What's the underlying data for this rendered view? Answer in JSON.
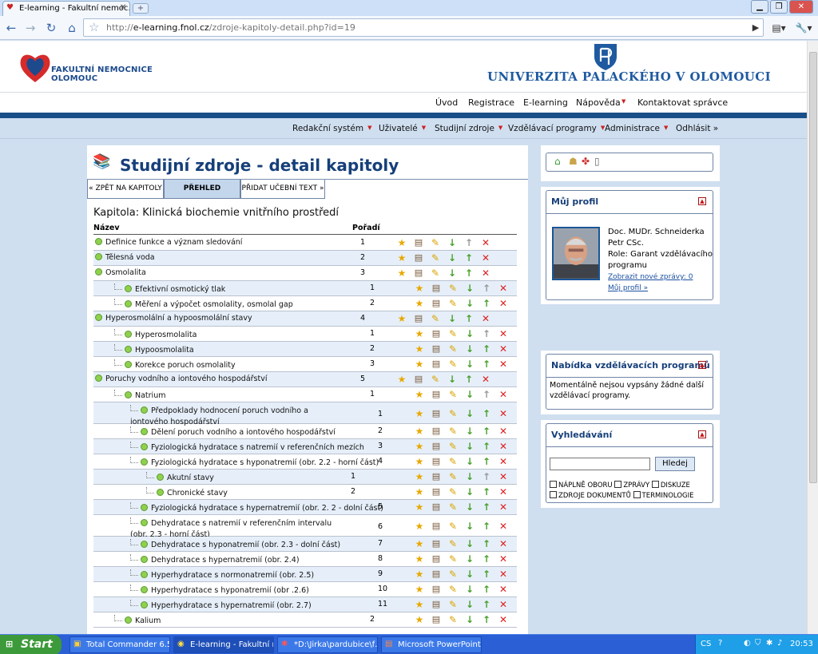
{
  "browser": {
    "tab_title": "E-learning - Fakultní nemoc…",
    "url_prefix": "http://",
    "url_host": "e-learning.fnol.cz",
    "url_path": "/zdroje-kapitoly-detail.php?id=19"
  },
  "header": {
    "fn_line1": "FAKULTNÍ NEMOCNICE",
    "fn_line2": "OLOMOUC",
    "up_name": "UNIVERZITA PALACKÉHO V OLOMOUCI"
  },
  "top_nav": [
    "Úvod",
    "Registrace",
    "E-learning",
    "Nápověda",
    "Kontaktovat správce"
  ],
  "main_nav": [
    "Redakční systém",
    "Uživatelé",
    "Studijní zdroje",
    "Vzdělávací programy",
    "Administrace",
    "Odhlásit »"
  ],
  "content": {
    "title": "Studijní zdroje - detail kapitoly",
    "tabs": [
      "« ZPĚT NA KAPITOLY",
      "PŘEHLED",
      "PŘIDAT UČEBNÍ TEXT »"
    ],
    "chapter": "Kapitola: Klinická biochemie vnitřního prostředí",
    "col_name": "Název",
    "col_order": "Pořadí",
    "rows": [
      {
        "name": "Definice funkce a význam sledování",
        "order": "1",
        "level": 0
      },
      {
        "name": "Tělesná voda",
        "order": "2",
        "level": 0
      },
      {
        "name": "Osmolalita",
        "order": "3",
        "level": 0
      },
      {
        "name": "Efektivní osmotický tlak",
        "order": "1",
        "level": 1
      },
      {
        "name": "Měření a výpočet osmolality, osmolal gap",
        "order": "2",
        "level": 1
      },
      {
        "name": "Hyperosmolální a hypoosmolální stavy",
        "order": "4",
        "level": 0
      },
      {
        "name": "Hyperosmolalita",
        "order": "1",
        "level": 1
      },
      {
        "name": "Hypoosmolalita",
        "order": "2",
        "level": 1
      },
      {
        "name": "Korekce poruch osmolality",
        "order": "3",
        "level": 1
      },
      {
        "name": "Poruchy vodního a iontového hospodářství",
        "order": "5",
        "level": 0
      },
      {
        "name": "Natrium",
        "order": "1",
        "level": 1
      },
      {
        "name": "Předpoklady hodnocení poruch vodního a iontového hospodářství",
        "order": "1",
        "level": 2
      },
      {
        "name": "Dělení poruch vodního a iontového hospodářství",
        "order": "2",
        "level": 2
      },
      {
        "name": "Fyziologická hydratace s natremií v referenčních mezích",
        "order": "3",
        "level": 2
      },
      {
        "name": "Fyziologická hydratace s hyponatremií (obr. 2.2 - horní část)",
        "order": "4",
        "level": 2
      },
      {
        "name": "Akutní stavy",
        "order": "1",
        "level": 3
      },
      {
        "name": "Chronické stavy",
        "order": "2",
        "level": 3
      },
      {
        "name": "Fyziologická hydratace s hypernatremií (obr. 2. 2 - dolní část)",
        "order": "5",
        "level": 2
      },
      {
        "name": "Dehydratace s natremií v referenčním intervalu (obr. 2.3 - horní část)",
        "order": "6",
        "level": 2
      },
      {
        "name": "Dehydratace s hyponatremií (obr. 2.3 - dolní část)",
        "order": "7",
        "level": 2
      },
      {
        "name": "Dehydratace s hypernatremií (obr. 2.4)",
        "order": "8",
        "level": 2
      },
      {
        "name": "Hyperhydratace s normonatremií (obr. 2.5)",
        "order": "9",
        "level": 2
      },
      {
        "name": "Hyperhydratace s hyponatremií (obr .2.6)",
        "order": "10",
        "level": 2
      },
      {
        "name": "Hyperhydratace s hypernatremií (obr. 2.7)",
        "order": "11",
        "level": 2
      },
      {
        "name": "Kalium",
        "order": "2",
        "level": 1
      }
    ]
  },
  "profile": {
    "title": "Můj profil",
    "name": "Doc. MUDr. Schneiderka Petr CSc.",
    "role": "Role: Garant vzdělávacího programu",
    "new_msgs": "Zobrazit nové zprávy: 0",
    "my_profile": "Můj profil »"
  },
  "offer": {
    "title": "Nabídka vzdělávacích programů",
    "text": "Momentálně nejsou vypsány žádné další vzdělávací programy."
  },
  "search": {
    "title": "Vyhledávání",
    "button": "Hledej",
    "checks": [
      "NÁPLNĚ OBORU",
      "ZPRÁVY",
      "DISKUZE",
      "ZDROJE DOKUMENTŮ",
      "TERMINOLOGIE"
    ]
  },
  "taskbar": {
    "start": "Start",
    "tasks": [
      "Total Commander 6.5…",
      "E-learning - Fakultní n…",
      "*D:\\Jirka\\pardubice\\f…",
      "Microsoft PowerPoint …"
    ],
    "lang": "CS",
    "clock": "20:53"
  }
}
